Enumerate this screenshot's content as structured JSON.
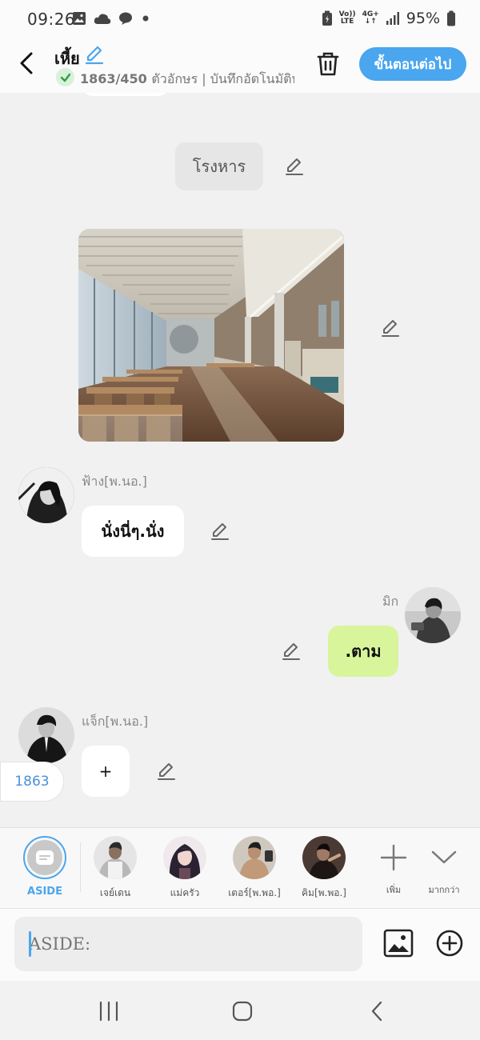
{
  "status_bar": {
    "time": "09:26",
    "battery": "95%",
    "network_top": "Vo))",
    "network_bottom": "LTE",
    "net_type": "4G+"
  },
  "header": {
    "title": "เหี้ย",
    "char_count": "1863/450",
    "char_count_suffix": "ตัวอักษร | บันทึกอัตโนมัติหล",
    "next_button": "ขั้นตอนต่อไป"
  },
  "chat": {
    "scene_label": "โรงหาร",
    "messages": [
      {
        "sender": "ฟ้าง[พ.นอ.]",
        "text": "นั่งนี่ๆ.นั่ง",
        "side": "left"
      },
      {
        "sender": "มิก",
        "text": ".ตาม",
        "side": "right"
      },
      {
        "sender": "แจ็ก[พ.นอ.]",
        "text": "+",
        "side": "left"
      }
    ],
    "count_pill": "1863"
  },
  "characters": {
    "aside_label": "ASIDE",
    "items": [
      {
        "name": "เจย์เดน",
        "color": "#6b6b6b"
      },
      {
        "name": "แม่ครัว",
        "color": "#7a5a6a"
      },
      {
        "name": "เตอร์[พ.พอ.]",
        "color": "#5a4a3a"
      },
      {
        "name": "คิม[พ.พอ.]",
        "color": "#3a2e2a"
      }
    ],
    "add_label": "เพิ่ม",
    "more_label": "มากกว่า"
  },
  "input": {
    "placeholder": "ASIDE:"
  },
  "colors": {
    "accent": "#4aa6ee",
    "green_bubble": "#d8f59c",
    "chat_bg": "#f1f1f1"
  }
}
